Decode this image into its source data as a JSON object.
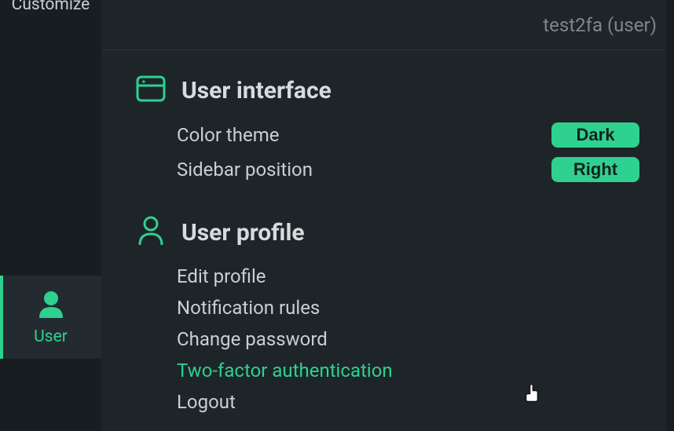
{
  "sidebar": {
    "top_label": "Customize",
    "active_label": "User"
  },
  "header": {
    "user_display": "test2fa (user)"
  },
  "sections": {
    "ui": {
      "title": "User interface",
      "color_theme": {
        "label": "Color theme",
        "value": "Dark"
      },
      "sidebar_pos": {
        "label": "Sidebar position",
        "value": "Right"
      }
    },
    "profile": {
      "title": "User profile",
      "items": [
        "Edit profile",
        "Notification rules",
        "Change password",
        "Two-factor authentication",
        "Logout"
      ]
    }
  },
  "hover_index": 3
}
